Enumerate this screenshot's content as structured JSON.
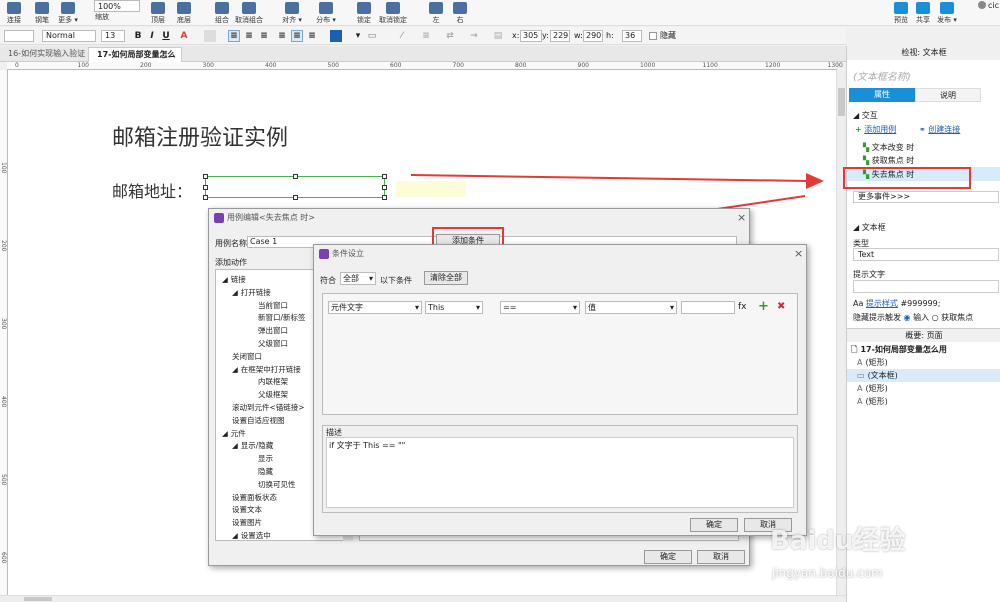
{
  "toolbar": {
    "buttons": [
      {
        "label": "连接",
        "icon": "link-icon"
      },
      {
        "label": "钢笔",
        "icon": "pen-icon"
      },
      {
        "label": "更多 ▾",
        "icon": "more-icon"
      },
      {
        "label": "缩放",
        "icon": "zoom-icon"
      },
      {
        "label": "顶层",
        "icon": "bring-front-icon"
      },
      {
        "label": "底层",
        "icon": "send-back-icon"
      },
      {
        "label": "组合",
        "icon": "group-icon"
      },
      {
        "label": "取消组合",
        "icon": "ungroup-icon"
      },
      {
        "label": "对齐 ▾",
        "icon": "align-icon"
      },
      {
        "label": "分布 ▾",
        "icon": "distribute-icon"
      },
      {
        "label": "锁定",
        "icon": "lock-icon"
      },
      {
        "label": "取消锁定",
        "icon": "unlock-icon"
      },
      {
        "label": "左",
        "icon": "left-icon"
      },
      {
        "label": "右",
        "icon": "right-icon"
      }
    ],
    "right_buttons": [
      {
        "label": "预览",
        "icon": "preview-icon"
      },
      {
        "label": "共享",
        "icon": "share-icon"
      },
      {
        "label": "发布 ▾",
        "icon": "publish-icon"
      }
    ],
    "user": "cic",
    "zoom": "100%"
  },
  "format_bar": {
    "font_style": "Normal",
    "font_size": "13",
    "bold": "B",
    "italic": "I",
    "underline": "U",
    "x_label": "x:",
    "x": "305",
    "y_label": "y:",
    "y": "229",
    "w_label": "w:",
    "w": "290",
    "h_label": "h:",
    "h": "36",
    "hide_label": "隐藏"
  },
  "tabs": [
    "16-如何实现输入验证",
    "17-如何局部变量怎么用"
  ],
  "ruler": {
    "h": [
      "0",
      "100",
      "200",
      "300",
      "400",
      "500",
      "600",
      "700",
      "800",
      "900",
      "1000",
      "1100",
      "1200",
      "1300"
    ],
    "v": [
      "100",
      "200",
      "300",
      "400",
      "500",
      "600"
    ]
  },
  "canvas": {
    "title": "邮箱注册验证实例",
    "email_label": "邮箱地址："
  },
  "right_panel": {
    "header": "检视: 文本框",
    "name_placeholder": "(文本框名称)",
    "tab_props": "属性",
    "tab_notes": "说明",
    "interaction_header": "交互",
    "add_case": "添加用例",
    "create_link": "创建连接",
    "events": [
      "文本改变 时",
      "获取焦点 时",
      "失去焦点 时"
    ],
    "more_events": "更多事件>>>",
    "textbox_header": "文本框",
    "type_label": "类型",
    "type_value": "Text",
    "hint_label": "提示文字",
    "hint_style_link": "提示样式",
    "hint_color": "#999999;",
    "hide_trigger_label": "隐藏提示触发",
    "opt_input": "输入",
    "opt_focus": "获取焦点",
    "outline_header": "概要: 页面",
    "outline_items": [
      "17-如何局部变量怎么用",
      "(矩形)",
      "(文本框)",
      "(矩形)",
      "(矩形)"
    ]
  },
  "case_editor": {
    "title": "用例编辑<失去焦点 时>",
    "case_name_label": "用例名称",
    "case_name": "Case 1",
    "add_condition": "添加条件",
    "add_action": "添加动作",
    "tree": [
      {
        "label": "链接",
        "lvl": 0,
        "exp": true
      },
      {
        "label": "打开链接",
        "lvl": 1,
        "exp": true
      },
      {
        "label": "当前窗口",
        "lvl": 2
      },
      {
        "label": "新窗口/新标签",
        "lvl": 2
      },
      {
        "label": "弹出窗口",
        "lvl": 2
      },
      {
        "label": "父级窗口",
        "lvl": 2
      },
      {
        "label": "关闭窗口",
        "lvl": 1
      },
      {
        "label": "在框架中打开链接",
        "lvl": 1,
        "exp": true
      },
      {
        "label": "内联框架",
        "lvl": 2
      },
      {
        "label": "父级框架",
        "lvl": 2
      },
      {
        "label": "滚动到元件<锚链接>",
        "lvl": 1
      },
      {
        "label": "设置自适应视图",
        "lvl": 1
      },
      {
        "label": "元件",
        "lvl": 0,
        "exp": true
      },
      {
        "label": "显示/隐藏",
        "lvl": 1,
        "exp": true
      },
      {
        "label": "显示",
        "lvl": 2
      },
      {
        "label": "隐藏",
        "lvl": 2
      },
      {
        "label": "切换可见性",
        "lvl": 2
      },
      {
        "label": "设置面板状态",
        "lvl": 1
      },
      {
        "label": "设置文本",
        "lvl": 1
      },
      {
        "label": "设置图片",
        "lvl": 1
      },
      {
        "label": "设置选中",
        "lvl": 1,
        "exp": true
      }
    ],
    "ok": "确定",
    "cancel": "取消"
  },
  "condition_dialog": {
    "title": "条件设立",
    "match_label": "符合",
    "match_value": "全部",
    "following": "以下条件",
    "clear_all": "清除全部",
    "row": {
      "type": "元件文字",
      "target": "This",
      "operator": "==",
      "value_type": "值",
      "value": ""
    },
    "fx": "fx",
    "add_symbol": "+",
    "remove_symbol": "✖",
    "desc_label": "描述",
    "description": "if 文字于 This == \"\"",
    "ok": "确定",
    "cancel": "取消"
  },
  "watermark": {
    "text": "Baidu经验",
    "url": "jingyan.baidu.com"
  },
  "colors": {
    "accent": "#1a8fd8",
    "annotation": "#e53935",
    "selection": "#4caf50"
  }
}
